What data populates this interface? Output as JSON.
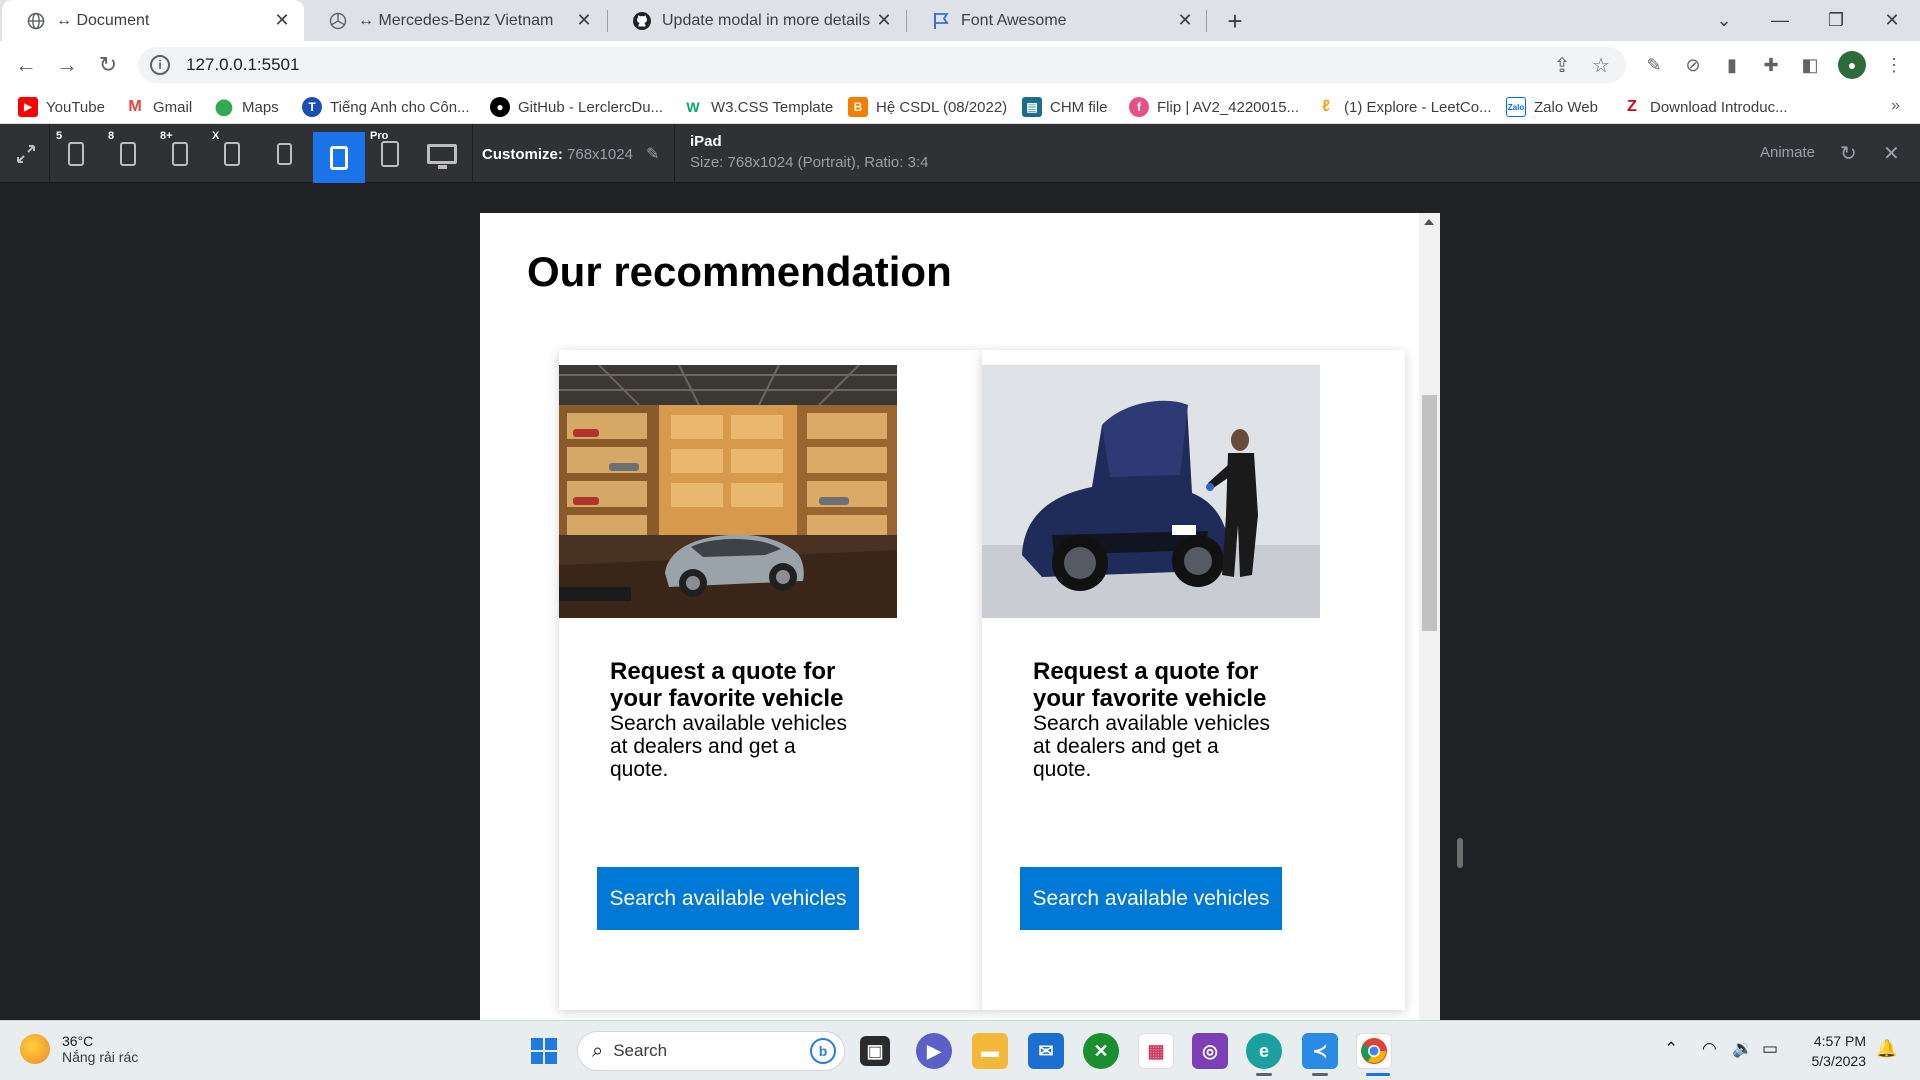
{
  "browser": {
    "tabs": [
      {
        "title": "↔ Document",
        "active": true,
        "icon": "globe-icon"
      },
      {
        "title": "↔ Mercedes-Benz Vietnam",
        "active": false,
        "icon": "mercedes-star-icon"
      },
      {
        "title": "Update modal in more details · N",
        "active": false,
        "icon": "github-icon"
      },
      {
        "title": "Font Awesome",
        "active": false,
        "icon": "flag-icon"
      }
    ],
    "url": "127.0.0.1:5501",
    "bookmarks": [
      {
        "label": "YouTube",
        "icon": "youtube-icon",
        "color": "#ff0000"
      },
      {
        "label": "Gmail",
        "icon": "gmail-icon",
        "color": "#ea4335"
      },
      {
        "label": "Maps",
        "icon": "maps-icon",
        "color": "#34a853"
      },
      {
        "label": "Tiếng Anh cho Côn...",
        "icon": "english-icon",
        "color": "#1a4fb5"
      },
      {
        "label": "GitHub - LerclercDu...",
        "icon": "github-icon",
        "color": "#000000"
      },
      {
        "label": "W3.CSS Template",
        "icon": "w3-icon",
        "color": "#04aa6d"
      },
      {
        "label": "Hệ CSDL (08/2022)",
        "icon": "blogger-icon",
        "color": "#f57d00"
      },
      {
        "label": "CHM file",
        "icon": "chm-icon",
        "color": "#1b6e8a"
      },
      {
        "label": "Flip | AV2_4220015...",
        "icon": "flip-icon",
        "color": "#e8508a"
      },
      {
        "label": "(1) Explore - LeetCo...",
        "icon": "leetcode-icon",
        "color": "#f89f1b"
      },
      {
        "label": "Zalo Web",
        "icon": "zalo-icon",
        "color": "#0068ff"
      },
      {
        "label": "Download Introduc...",
        "icon": "zlib-icon",
        "color": "#d0021b"
      }
    ]
  },
  "devtools": {
    "device_labels": [
      "5",
      "8",
      "8+",
      "X",
      "",
      "",
      "Pro",
      ""
    ],
    "customize_label": "Customize:",
    "customize_value": "768x1024",
    "device_name": "iPad",
    "device_size": "Size: 768x1024 (Portrait), Ratio: 3:4",
    "animate_label": "Animate"
  },
  "page": {
    "title": "Our recommendation",
    "cards": [
      {
        "image": "car-warehouse-photo",
        "heading": "Request a quote for your favorite vehicle",
        "description": "Search available vehicles at dealers and get a quote.",
        "button": "Search available vehicles"
      },
      {
        "image": "car-mechanic-photo",
        "heading": "Request a quote for your favorite vehicle",
        "description": "Search available vehicles at dealers and get a quote.",
        "button": "Search available vehicles"
      }
    ]
  },
  "taskbar": {
    "weather_temp": "36°C",
    "weather_desc": "Nắng rải rác",
    "search_placeholder": "Search",
    "time": "4:57 PM",
    "date": "5/3/2023"
  },
  "colors": {
    "accent": "#0078d6",
    "devtools_bg": "#303134",
    "selected_device": "#1a73e8"
  }
}
